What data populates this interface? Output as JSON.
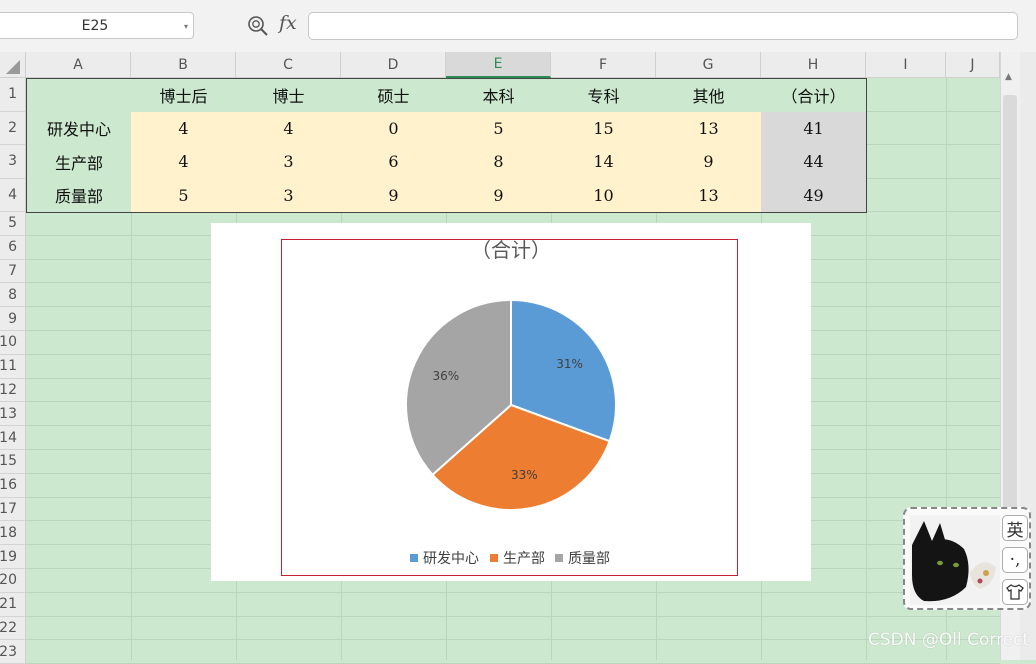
{
  "formula_bar": {
    "cell_ref": "E25",
    "fx_label": "fx",
    "formula_value": ""
  },
  "columns": [
    "A",
    "B",
    "C",
    "D",
    "E",
    "F",
    "G",
    "H",
    "I",
    "J"
  ],
  "selected_column": "E",
  "rows": [
    "1",
    "2",
    "3",
    "4",
    "5",
    "6",
    "7",
    "8",
    "9",
    "10",
    "11",
    "12",
    "13",
    "14",
    "15",
    "16",
    "17",
    "18",
    "19",
    "20",
    "21",
    "22",
    "23"
  ],
  "table": {
    "headers": [
      "",
      "博士后",
      "博士",
      "硕士",
      "本科",
      "专科",
      "其他",
      "（合计）"
    ],
    "data": [
      {
        "label": "研发中心",
        "values": [
          "4",
          "4",
          "0",
          "5",
          "15",
          "13"
        ],
        "total": "41"
      },
      {
        "label": "生产部",
        "values": [
          "4",
          "3",
          "6",
          "8",
          "14",
          "9"
        ],
        "total": "44"
      },
      {
        "label": "质量部",
        "values": [
          "5",
          "3",
          "9",
          "9",
          "10",
          "13"
        ],
        "total": "49"
      }
    ]
  },
  "chart_data": {
    "type": "pie",
    "title": "（合计）",
    "categories": [
      "研发中心",
      "生产部",
      "质量部"
    ],
    "values": [
      41,
      44,
      49
    ],
    "data_labels": [
      "31%",
      "33%",
      "36%"
    ],
    "colors": [
      "#5b9bd5",
      "#ed7d31",
      "#a5a5a5"
    ],
    "legend": "bottom"
  },
  "ime": {
    "lang_label": "英",
    "punct_label": "·,",
    "shirt_icon": "shirt-icon"
  },
  "watermark": "CSDN @Oll Correct",
  "colors": {
    "sheet_bg": "#cce8cf",
    "value_fill": "#fff2cc",
    "total_fill": "#d9d9d9",
    "frame_red": "#c9202f",
    "selected_col": "#2e8b57"
  }
}
